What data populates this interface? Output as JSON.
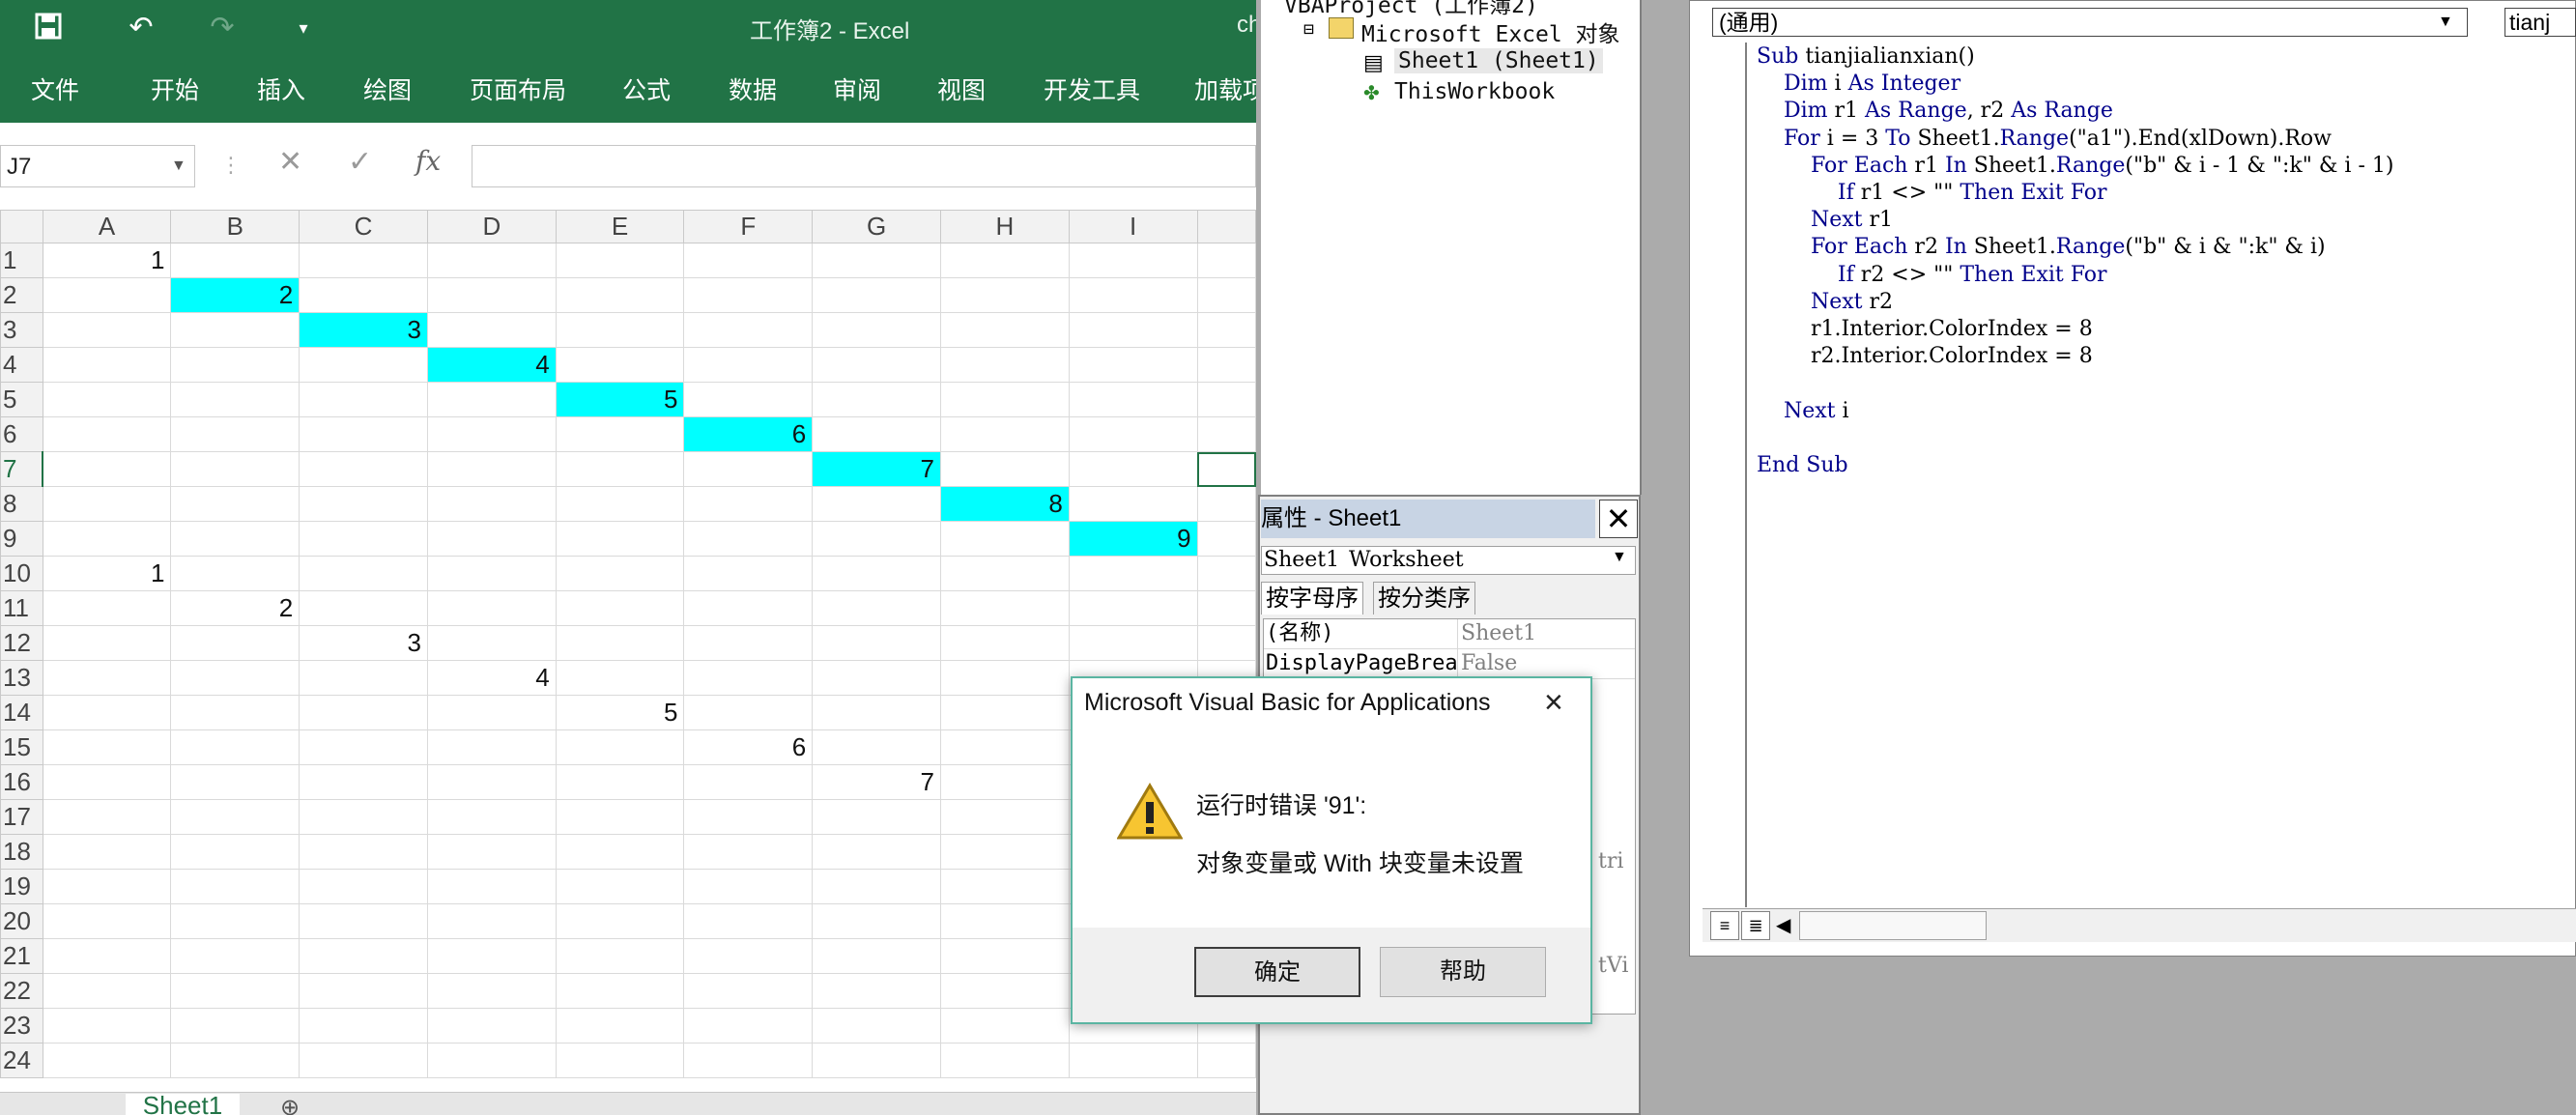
{
  "excel": {
    "title": "工作簿2  -  Excel",
    "user_partial": "ch",
    "tabs": [
      "文件",
      "开始",
      "插入",
      "绘图",
      "页面布局",
      "公式",
      "数据",
      "审阅",
      "视图",
      "开发工具",
      "加载项"
    ],
    "name_box": "J7",
    "fx": "fx",
    "columns": [
      "A",
      "B",
      "C",
      "D",
      "E",
      "F",
      "G",
      "H",
      "I"
    ],
    "rows": [
      "1",
      "2",
      "3",
      "4",
      "5",
      "6",
      "7",
      "8",
      "9",
      "10",
      "11",
      "12",
      "13",
      "14",
      "15",
      "16",
      "17",
      "18",
      "19",
      "20",
      "21",
      "22",
      "23",
      "24"
    ],
    "sheet_tab": "Sheet1"
  },
  "cells": {
    "r1": [
      "1",
      "",
      "",
      "",
      "",
      "",
      "",
      "",
      ""
    ],
    "r2": [
      "",
      "2",
      "",
      "",
      "",
      "",
      "",
      "",
      ""
    ],
    "r3": [
      "",
      "",
      "3",
      "",
      "",
      "",
      "",
      "",
      ""
    ],
    "r4": [
      "",
      "",
      "",
      "4",
      "",
      "",
      "",
      "",
      ""
    ],
    "r5": [
      "",
      "",
      "",
      "",
      "5",
      "",
      "",
      "",
      ""
    ],
    "r6": [
      "",
      "",
      "",
      "",
      "",
      "6",
      "",
      "",
      ""
    ],
    "r7": [
      "",
      "",
      "",
      "",
      "",
      "",
      "7",
      "",
      ""
    ],
    "r8": [
      "",
      "",
      "",
      "",
      "",
      "",
      "",
      "8",
      ""
    ],
    "r9": [
      "",
      "",
      "",
      "",
      "",
      "",
      "",
      "",
      "9"
    ],
    "r10": [
      "1",
      "",
      "",
      "",
      "",
      "",
      "",
      "",
      ""
    ],
    "r11": [
      "",
      "2",
      "",
      "",
      "",
      "",
      "",
      "",
      ""
    ],
    "r12": [
      "",
      "",
      "3",
      "",
      "",
      "",
      "",
      "",
      ""
    ],
    "r13": [
      "",
      "",
      "",
      "4",
      "",
      "",
      "",
      "",
      ""
    ],
    "r14": [
      "",
      "",
      "",
      "",
      "5",
      "",
      "",
      "",
      ""
    ],
    "r15": [
      "",
      "",
      "",
      "",
      "",
      "6",
      "",
      "",
      ""
    ],
    "r16": [
      "",
      "",
      "",
      "",
      "",
      "",
      "7",
      "",
      ""
    ]
  },
  "fill_color": "#00ffff",
  "project": {
    "root": "VBAProject (工作簿2)",
    "folder": "Microsoft Excel 对象",
    "sheet": "Sheet1 (Sheet1)",
    "workbook": "ThisWorkbook"
  },
  "properties": {
    "title": "属性 - Sheet1",
    "object_name": "Sheet1",
    "object_type": "Worksheet",
    "tab_alpha": "按字母序",
    "tab_category": "按分类序",
    "rows": [
      {
        "name": "(名称)",
        "value": "Sheet1"
      },
      {
        "name": "DisplayPageBrea",
        "value": "False"
      }
    ],
    "partial_values": [
      "tri",
      "tVi"
    ]
  },
  "code": {
    "proc_general": "(通用)",
    "proc_name_partial": "tianj",
    "lines": [
      "Sub tianjialianxian()",
      "    Dim i As Integer",
      "    Dim r1 As Range, r2 As Range",
      "    For i = 3 To Sheet1.Range(\"a1\").End(xlDown).Row",
      "        For Each r1 In Sheet1.Range(\"b\" & i - 1 & \":k\" & i - 1)",
      "            If r1 <> \"\" Then Exit For",
      "        Next r1",
      "        For Each r2 In Sheet1.Range(\"b\" & i & \":k\" & i)",
      "            If r2 <> \"\" Then Exit For",
      "        Next r2",
      "        r1.Interior.ColorIndex = 8",
      "        r2.Interior.ColorIndex = 8",
      "",
      "    Next i",
      "",
      "End Sub"
    ]
  },
  "dialog": {
    "title": "Microsoft Visual Basic for Applications",
    "message1": "运行时错误 '91':",
    "message2": "对象变量或 With 块变量未设置",
    "ok": "确定",
    "help": "帮助"
  }
}
